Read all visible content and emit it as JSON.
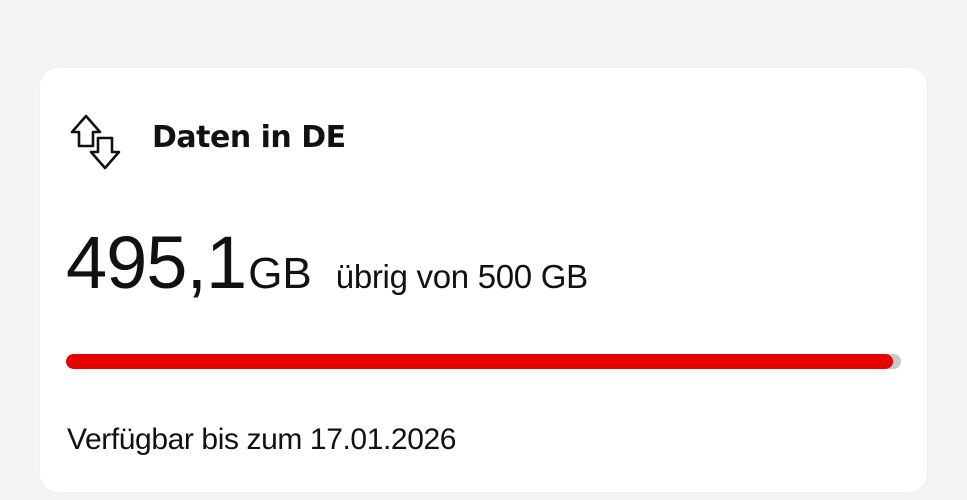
{
  "card": {
    "title": "Daten in DE",
    "icon": "data-transfer-arrows-icon",
    "amount": {
      "value": "495,1",
      "unit": "GB",
      "suffix": "übrig von 500 GB"
    },
    "usage": {
      "remaining_fraction": 0.99,
      "fill_color": "#e60000",
      "track_color": "#c8c8c8"
    },
    "footer": "Verfügbar bis zum 17.01.2026"
  }
}
